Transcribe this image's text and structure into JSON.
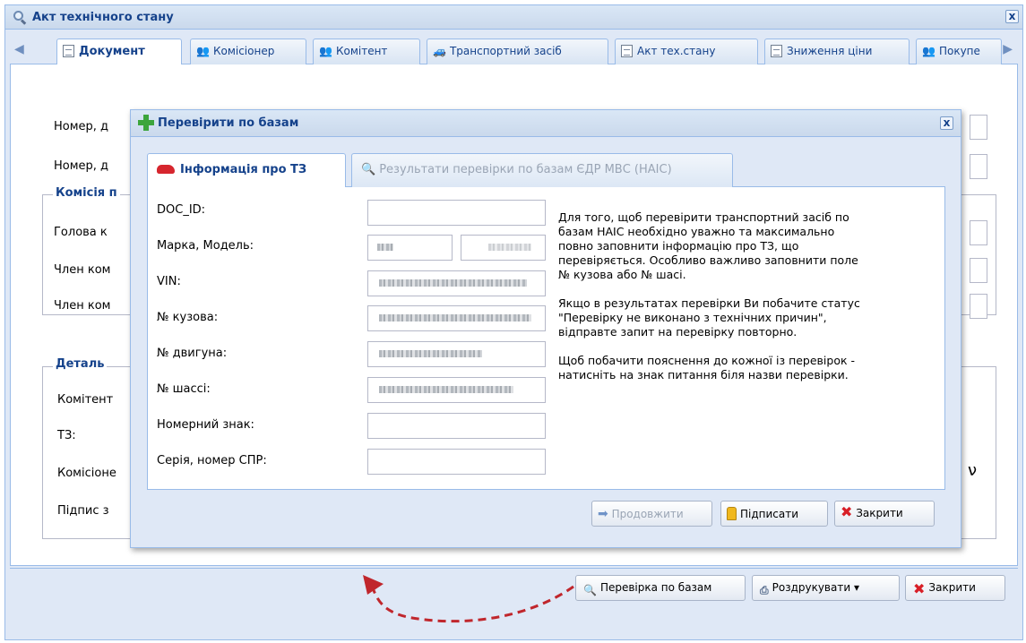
{
  "window": {
    "title": "Акт технічного стану",
    "close_label": "x"
  },
  "tabs": [
    {
      "label": "Документ",
      "icon": "document-icon"
    },
    {
      "label": "Комісіонер",
      "icon": "people-icon"
    },
    {
      "label": "Комітент",
      "icon": "people-icon"
    },
    {
      "label": "Транспортний засіб",
      "icon": "car-icon"
    },
    {
      "label": "Акт тех.стану",
      "icon": "document-icon"
    },
    {
      "label": "Зниження ціни",
      "icon": "document-icon"
    },
    {
      "label": "Покупе",
      "icon": "people-icon"
    }
  ],
  "doc": {
    "labels": {
      "num1": "Номер, д",
      "num2": "Номер, д",
      "head": "Голова к",
      "member1": "Член ком",
      "member2": "Член ком",
      "kom": "Комітент",
      "tz": "ТЗ:",
      "komis": "Комісіоне",
      "sign": "Підпис з"
    },
    "legend_commission": "Комісія п",
    "legend_details": "Деталь",
    "tail_char": "ν"
  },
  "footer": {
    "check_button": "Перевірка по базам",
    "print_button": "Роздрукувати",
    "close_button": "Закрити"
  },
  "modal": {
    "title": "Перевірити по базам",
    "close_label": "x",
    "tabs": [
      {
        "label": "Інформація про ТЗ"
      },
      {
        "label": "Результати перевірки по базам ЄДР МВС (НАІС)"
      }
    ],
    "fields": [
      {
        "label": "DOC_ID:",
        "value": ""
      },
      {
        "label": "Марка, Модель:",
        "value": ""
      },
      {
        "label": "VIN:",
        "value": ""
      },
      {
        "label": "№ кузова:",
        "value": ""
      },
      {
        "label": "№ двигуна:",
        "value": ""
      },
      {
        "label": "№ шассі:",
        "value": ""
      },
      {
        "label": "Номерний знак:",
        "value": ""
      },
      {
        "label": "Серія, номер СПР:",
        "value": ""
      }
    ],
    "info_text": "Для того, щоб перевірити транспортний засіб по\nбазам НАІС необхідно уважно та максимально\nповно заповнити інформацію про ТЗ, що\nперевіряється. Особливо важливо заповнити поле\n№ кузова або № шасі.\n\nЯкщо в результатах перевірки Ви побачите статус\n\"Перевірку не виконано з технічних причин\",\nвідправте запит на перевірку повторно.\n\nЩоб побачити пояснення до кожної із перевірок -\nнатисніть на знак питання біля назви перевірки.",
    "buttons": {
      "continue": "Продовжити",
      "sign": "Підписати",
      "close": "Закрити"
    }
  },
  "colors": {
    "accent": "#15428b",
    "border": "#99bbe8",
    "arrow": "#c0262c"
  }
}
